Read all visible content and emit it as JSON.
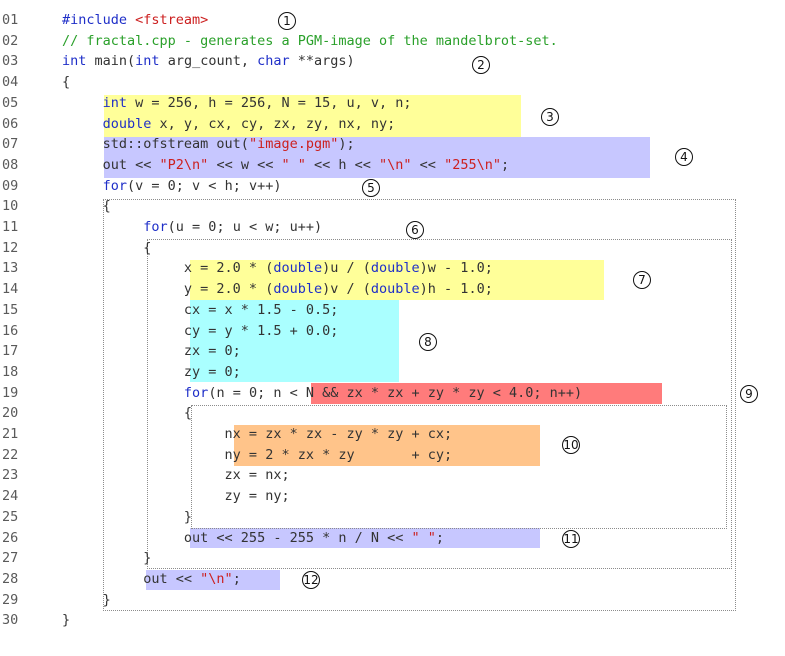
{
  "lines": [
    {
      "n": "01",
      "tokens": [
        {
          "t": "#include ",
          "c": "kw"
        },
        {
          "t": "<fstream>",
          "c": "str"
        }
      ]
    },
    {
      "n": "02",
      "tokens": [
        {
          "t": "// fractal.cpp - generates a PGM-image of the mandelbrot-set.",
          "c": "cmt"
        }
      ]
    },
    {
      "n": "03",
      "tokens": [
        {
          "t": "int",
          "c": "kw"
        },
        {
          "t": " main(",
          "c": "plain"
        },
        {
          "t": "int",
          "c": "kw"
        },
        {
          "t": " arg_count, ",
          "c": "plain"
        },
        {
          "t": "char",
          "c": "kw"
        },
        {
          "t": " **args)",
          "c": "plain"
        }
      ]
    },
    {
      "n": "04",
      "tokens": [
        {
          "t": "{",
          "c": "plain"
        }
      ]
    },
    {
      "n": "05",
      "tokens": [
        {
          "t": "     ",
          "c": "plain"
        },
        {
          "t": "int",
          "c": "kw"
        },
        {
          "t": " w = 256, h = 256, N = 15, u, v, n;",
          "c": "plain"
        }
      ]
    },
    {
      "n": "06",
      "tokens": [
        {
          "t": "     ",
          "c": "plain"
        },
        {
          "t": "double",
          "c": "kw"
        },
        {
          "t": " x, y, cx, cy, zx, zy, nx, ny;",
          "c": "plain"
        }
      ]
    },
    {
      "n": "07",
      "tokens": [
        {
          "t": "     std::ofstream out(",
          "c": "plain"
        },
        {
          "t": "\"image.pgm\"",
          "c": "str"
        },
        {
          "t": ");",
          "c": "plain"
        }
      ]
    },
    {
      "n": "08",
      "tokens": [
        {
          "t": "     out << ",
          "c": "plain"
        },
        {
          "t": "\"P2\\n\"",
          "c": "str"
        },
        {
          "t": " << w << ",
          "c": "plain"
        },
        {
          "t": "\" \"",
          "c": "str"
        },
        {
          "t": " << h << ",
          "c": "plain"
        },
        {
          "t": "\"\\n\"",
          "c": "str"
        },
        {
          "t": " << ",
          "c": "plain"
        },
        {
          "t": "\"255\\n\"",
          "c": "str"
        },
        {
          "t": ";",
          "c": "plain"
        }
      ]
    },
    {
      "n": "09",
      "tokens": [
        {
          "t": "     ",
          "c": "plain"
        },
        {
          "t": "for",
          "c": "kw"
        },
        {
          "t": "(v = 0; v < h; v++)",
          "c": "plain"
        }
      ]
    },
    {
      "n": "10",
      "tokens": [
        {
          "t": "     {",
          "c": "plain"
        }
      ]
    },
    {
      "n": "11",
      "tokens": [
        {
          "t": "          ",
          "c": "plain"
        },
        {
          "t": "for",
          "c": "kw"
        },
        {
          "t": "(u = 0; u < w; u++)",
          "c": "plain"
        }
      ]
    },
    {
      "n": "12",
      "tokens": [
        {
          "t": "          {",
          "c": "plain"
        }
      ]
    },
    {
      "n": "13",
      "tokens": [
        {
          "t": "               x = 2.0 * (",
          "c": "plain"
        },
        {
          "t": "double",
          "c": "kw"
        },
        {
          "t": ")u / (",
          "c": "plain"
        },
        {
          "t": "double",
          "c": "kw"
        },
        {
          "t": ")w - 1.0;",
          "c": "plain"
        }
      ]
    },
    {
      "n": "14",
      "tokens": [
        {
          "t": "               y = 2.0 * (",
          "c": "plain"
        },
        {
          "t": "double",
          "c": "kw"
        },
        {
          "t": ")v / (",
          "c": "plain"
        },
        {
          "t": "double",
          "c": "kw"
        },
        {
          "t": ")h - 1.0;",
          "c": "plain"
        }
      ]
    },
    {
      "n": "15",
      "tokens": [
        {
          "t": "               cx = x * 1.5 - 0.5;",
          "c": "plain"
        }
      ]
    },
    {
      "n": "16",
      "tokens": [
        {
          "t": "               cy = y * 1.5 + 0.0;",
          "c": "plain"
        }
      ]
    },
    {
      "n": "17",
      "tokens": [
        {
          "t": "               zx = 0;",
          "c": "plain"
        }
      ]
    },
    {
      "n": "18",
      "tokens": [
        {
          "t": "               zy = 0;",
          "c": "plain"
        }
      ]
    },
    {
      "n": "19",
      "tokens": [
        {
          "t": "               ",
          "c": "plain"
        },
        {
          "t": "for",
          "c": "kw"
        },
        {
          "t": "(n = 0; n < N && zx * zx + zy * zy < 4.0; n++)",
          "c": "plain"
        }
      ]
    },
    {
      "n": "20",
      "tokens": [
        {
          "t": "               {",
          "c": "plain"
        }
      ]
    },
    {
      "n": "21",
      "tokens": [
        {
          "t": "                    nx = zx * zx - zy * zy + cx;",
          "c": "plain"
        }
      ]
    },
    {
      "n": "22",
      "tokens": [
        {
          "t": "                    ny = 2 * zx * zy       + cy;",
          "c": "plain"
        }
      ]
    },
    {
      "n": "23",
      "tokens": [
        {
          "t": "                    zx = nx;",
          "c": "plain"
        }
      ]
    },
    {
      "n": "24",
      "tokens": [
        {
          "t": "                    zy = ny;",
          "c": "plain"
        }
      ]
    },
    {
      "n": "25",
      "tokens": [
        {
          "t": "               }",
          "c": "plain"
        }
      ]
    },
    {
      "n": "26",
      "tokens": [
        {
          "t": "               out << 255 - 255 * n / N << ",
          "c": "plain"
        },
        {
          "t": "\" \"",
          "c": "str"
        },
        {
          "t": ";",
          "c": "plain"
        }
      ]
    },
    {
      "n": "27",
      "tokens": [
        {
          "t": "          }",
          "c": "plain"
        }
      ]
    },
    {
      "n": "28",
      "tokens": [
        {
          "t": "          out << ",
          "c": "plain"
        },
        {
          "t": "\"\\n\"",
          "c": "str"
        },
        {
          "t": ";",
          "c": "plain"
        }
      ]
    },
    {
      "n": "29",
      "tokens": [
        {
          "t": "     }",
          "c": "plain"
        }
      ]
    },
    {
      "n": "30",
      "tokens": [
        {
          "t": "}",
          "c": "plain"
        }
      ]
    }
  ],
  "markers": [
    "1",
    "2",
    "3",
    "4",
    "5",
    "6",
    "7",
    "8",
    "9",
    "10",
    "11",
    "12"
  ],
  "colors": {
    "keyword": "#1f2fc8",
    "string": "#cc1f1f",
    "comment": "#2aa02a",
    "highlight_yellow": "#ffff99",
    "highlight_purple": "#c7c7ff",
    "highlight_cyan": "#aaffff",
    "highlight_red": "#ff7b7b",
    "highlight_orange": "#ffc48a"
  }
}
